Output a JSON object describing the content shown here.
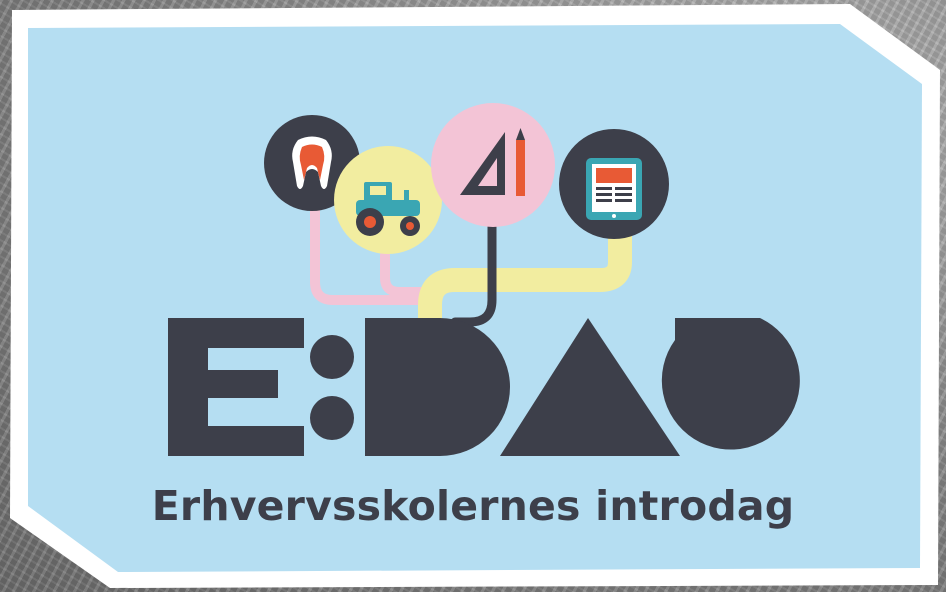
{
  "brand": {
    "logo_text": "E:DAG",
    "tagline": "Erhvervsskolernes introdag"
  },
  "icons": [
    {
      "name": "tooth-icon",
      "circle_color": "#3d3f4a"
    },
    {
      "name": "tractor-icon",
      "circle_color": "#f2eda0"
    },
    {
      "name": "set-square-pencil-icon",
      "circle_color": "#f3c4d6"
    },
    {
      "name": "tablet-icon",
      "circle_color": "#3d3f4a"
    }
  ],
  "colors": {
    "panel": "#b5def2",
    "frame": "#ffffff",
    "ink": "#3d3f4a",
    "line_pink": "#f3c4d6",
    "line_yellow": "#f2eda0",
    "accent_orange": "#e85a35",
    "accent_teal": "#3aa6b3"
  }
}
